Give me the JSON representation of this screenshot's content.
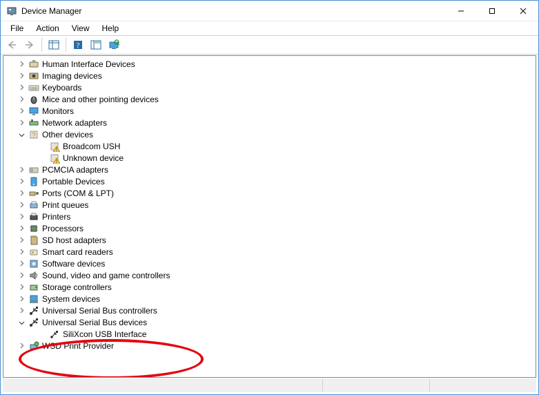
{
  "window": {
    "title": "Device Manager"
  },
  "menu": {
    "file": "File",
    "action": "Action",
    "view": "View",
    "help": "Help"
  },
  "categories": [
    {
      "icon": "hid",
      "label": "Human Interface Devices",
      "expanded": false
    },
    {
      "icon": "imaging",
      "label": "Imaging devices",
      "expanded": false
    },
    {
      "icon": "keyboard",
      "label": "Keyboards",
      "expanded": false
    },
    {
      "icon": "mouse",
      "label": "Mice and other pointing devices",
      "expanded": false
    },
    {
      "icon": "monitor",
      "label": "Monitors",
      "expanded": false
    },
    {
      "icon": "network",
      "label": "Network adapters",
      "expanded": false
    },
    {
      "icon": "other",
      "label": "Other devices",
      "expanded": true,
      "children": [
        {
          "icon": "warn",
          "label": "Broadcom USH"
        },
        {
          "icon": "warn",
          "label": "Unknown device"
        }
      ]
    },
    {
      "icon": "pcmcia",
      "label": "PCMCIA adapters",
      "expanded": false
    },
    {
      "icon": "portable",
      "label": "Portable Devices",
      "expanded": false
    },
    {
      "icon": "ports",
      "label": "Ports (COM & LPT)",
      "expanded": false
    },
    {
      "icon": "printq",
      "label": "Print queues",
      "expanded": false
    },
    {
      "icon": "printer",
      "label": "Printers",
      "expanded": false
    },
    {
      "icon": "cpu",
      "label": "Processors",
      "expanded": false
    },
    {
      "icon": "sd",
      "label": "SD host adapters",
      "expanded": false
    },
    {
      "icon": "smart",
      "label": "Smart card readers",
      "expanded": false
    },
    {
      "icon": "soft",
      "label": "Software devices",
      "expanded": false
    },
    {
      "icon": "sound",
      "label": "Sound, video and game controllers",
      "expanded": false
    },
    {
      "icon": "storage",
      "label": "Storage controllers",
      "expanded": false
    },
    {
      "icon": "system",
      "label": "System devices",
      "expanded": false
    },
    {
      "icon": "usbctrl",
      "label": "Universal Serial Bus controllers",
      "expanded": false
    },
    {
      "icon": "usbdev",
      "label": "Universal Serial Bus devices",
      "expanded": true,
      "children": [
        {
          "icon": "usb",
          "label": "SiliXcon USB Interface"
        }
      ]
    },
    {
      "icon": "wsd",
      "label": "WSD Print Provider",
      "expanded": false
    }
  ],
  "annotation": {
    "shape": "ellipse",
    "color": "#e30613"
  }
}
